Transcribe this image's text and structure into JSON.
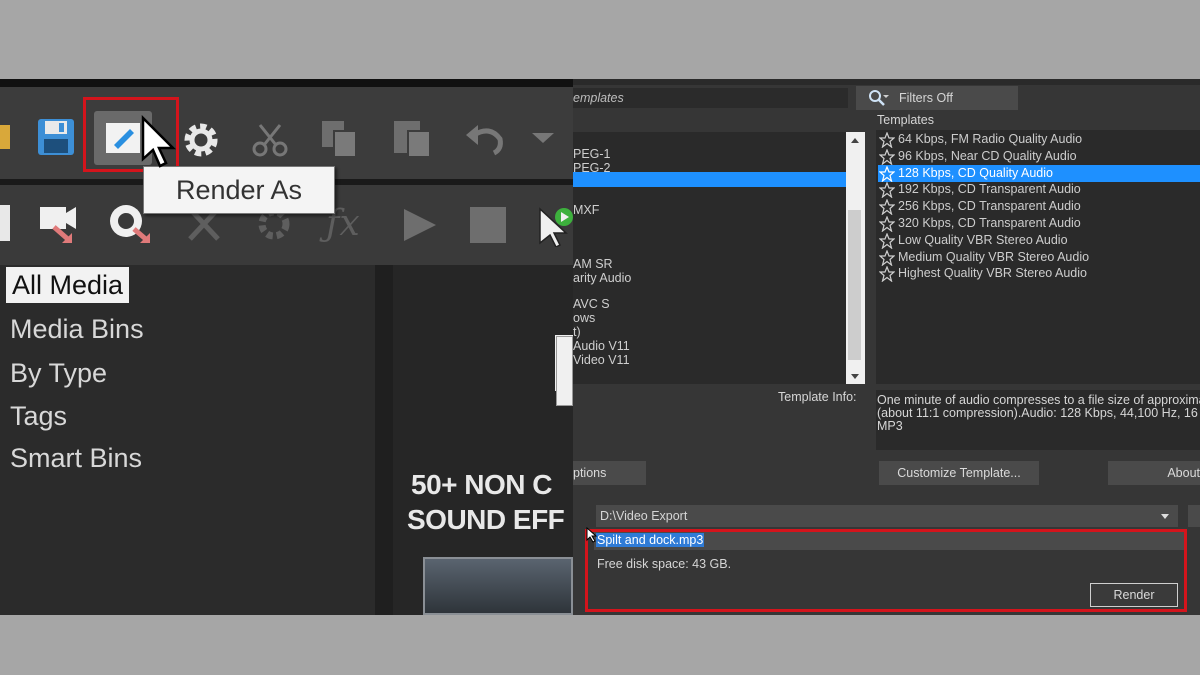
{
  "left": {
    "tooltip": "Render As",
    "media_tree": [
      {
        "label": "All Media",
        "selected": true
      },
      {
        "label": "Media Bins",
        "selected": false
      },
      {
        "label": "By Type",
        "selected": false
      },
      {
        "label": "Tags",
        "selected": false
      },
      {
        "label": "Smart Bins",
        "selected": false
      }
    ],
    "promo_line1": "50+ NON C",
    "promo_line2": "SOUND EFF"
  },
  "right": {
    "templates_search_text": "emplates",
    "filters_label": "Filters Off",
    "templates_heading": "Templates",
    "format_list": [
      "PEG-1",
      "PEG-2",
      "",
      "",
      "MXF",
      "",
      "",
      "AM SR",
      "arity Audio",
      "",
      "AVC S",
      "ows",
      "t)",
      "Audio V11",
      "Video V11"
    ],
    "templates": [
      {
        "label": "64 Kbps, FM Radio Quality Audio",
        "selected": false
      },
      {
        "label": "96 Kbps, Near CD Quality Audio",
        "selected": false
      },
      {
        "label": "128 Kbps, CD Quality Audio",
        "selected": true
      },
      {
        "label": "192 Kbps, CD Transparent Audio",
        "selected": false
      },
      {
        "label": "256 Kbps, CD Transparent Audio",
        "selected": false
      },
      {
        "label": "320 Kbps, CD Transparent Audio",
        "selected": false
      },
      {
        "label": "Low Quality VBR Stereo Audio",
        "selected": false
      },
      {
        "label": "Medium Quality VBR Stereo Audio",
        "selected": false
      },
      {
        "label": "Highest Quality VBR Stereo Audio",
        "selected": false
      }
    ],
    "template_info_label": "Template Info:",
    "template_info_line1": "One minute of audio compresses to a file size of approximat",
    "template_info_line2": "(about 11:1 compression).Audio: 128 Kbps, 44,100 Hz, 16",
    "template_info_line3": "MP3",
    "options_button": "ptions",
    "customize_button": "Customize Template...",
    "about_button": "About",
    "folder_path": "D:\\Video Export",
    "filename": "Spilt and dock.mp3",
    "free_disk": "Free disk space: 43 GB.",
    "render_button": "Render"
  },
  "colors": {
    "highlight_red": "#d4141c",
    "selection_blue": "#1e90ff"
  }
}
